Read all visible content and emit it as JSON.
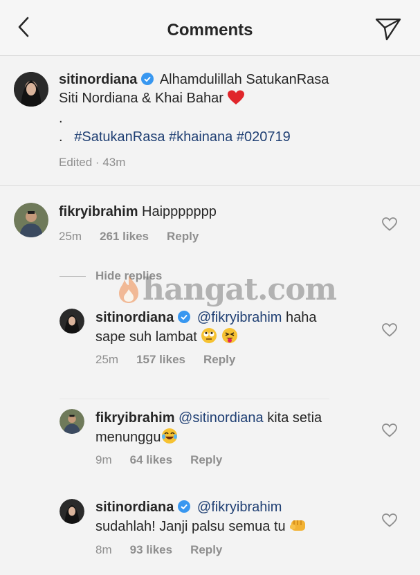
{
  "header": {
    "title": "Comments"
  },
  "post": {
    "username": "sitinordiana",
    "caption_line1": "Alhamdulillah SatukanRasa",
    "caption_line2": "Siti Nordiana & Khai Bahar",
    "dot1": ".",
    "dot2": ".",
    "hashtags": "#SatukanRasa #khainana #020719",
    "edited": "Edited",
    "time": "43m"
  },
  "comments": [
    {
      "username": "fikryibrahim",
      "text": "Haippppppp",
      "time": "25m",
      "likes": "261 likes",
      "reply": "Reply"
    },
    {
      "username": "sitinordiana",
      "mention": "@fikryibrahim",
      "text1": "haha",
      "text2": "sape suh lambat",
      "time": "25m",
      "likes": "157 likes",
      "reply": "Reply"
    },
    {
      "username": "fikryibrahim",
      "mention": "@sitinordiana",
      "text1": "kita setia",
      "text2": "menunggu",
      "time": "9m",
      "likes": "64 likes",
      "reply": "Reply"
    },
    {
      "username": "sitinordiana",
      "mention": "@fikryibrahim",
      "text2": "sudahlah! Janji palsu semua tu",
      "time": "8m",
      "likes": "93 likes",
      "reply": "Reply"
    }
  ],
  "hide_replies": "Hide replies",
  "watermark": "hangat.com",
  "colors": {
    "verified": "#3897f0",
    "link": "#1f3f73",
    "muted": "#8e8e8e",
    "heart": "#ed4956"
  }
}
